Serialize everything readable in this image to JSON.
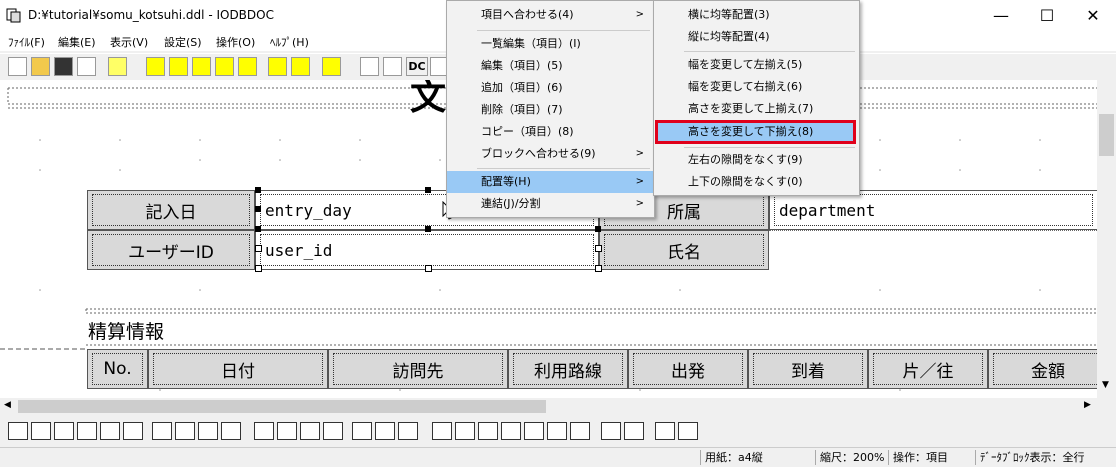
{
  "window": {
    "title": "D:¥tutorial¥somu_kotsuhi.ddl - IODBDOC",
    "controls": {
      "minimize": "—",
      "maximize": "☐",
      "close": "✕"
    }
  },
  "menubar": [
    "ﾌｧｲﾙ(F)",
    "編集(E)",
    "表示(V)",
    "設定(S)",
    "操作(O)",
    "ﾍﾙﾌﾟ(H)"
  ],
  "toolbar": {
    "dc_label": "DC"
  },
  "canvas": {
    "header_char": "文",
    "row1": {
      "label1": "記入日",
      "value1": "entry_day",
      "label2": "所属",
      "value2": "department"
    },
    "row2": {
      "label1": "ユーザーID",
      "value1": "user_id",
      "label2": "氏名"
    },
    "section_title": "精算情報",
    "table_headers": [
      "No.",
      "日付",
      "訪問先",
      "利用路線",
      "出発",
      "到着",
      "片／往",
      "金額"
    ]
  },
  "context_menu": {
    "items": [
      {
        "label": "項目へ合わせる(4)",
        "submenu": true
      },
      {
        "label": "一覧編集（項目）(I)"
      },
      {
        "label": "編集（項目）(5)"
      },
      {
        "label": "追加（項目）(6)"
      },
      {
        "label": "削除（項目）(7)"
      },
      {
        "label": "コピー（項目）(8)"
      },
      {
        "label": "ブロックへ合わせる(9)",
        "submenu": true
      },
      {
        "label": "配置等(H)",
        "submenu": true,
        "highlighted": true
      },
      {
        "label": "連結(J)/分割",
        "submenu": true
      }
    ]
  },
  "submenu": {
    "items": [
      {
        "label": "横に均等配置(3)"
      },
      {
        "label": "縦に均等配置(4)"
      },
      {
        "label": "幅を変更して左揃え(5)"
      },
      {
        "label": "幅を変更して右揃え(6)"
      },
      {
        "label": "高さを変更して上揃え(7)"
      },
      {
        "label": "高さを変更して下揃え(8)",
        "highlighted": true
      },
      {
        "label": "左右の隙間をなくす(9)"
      },
      {
        "label": "上下の隙間をなくす(0)"
      }
    ],
    "highlight_color": "#99c9f5",
    "outline_color": "#e0001b"
  },
  "statusbar": {
    "paper": "用紙：a4縦",
    "zoom": "縮尺：200%",
    "mode": "操作：項目",
    "block": "ﾃﾞｰﾀﾌﾞﾛｯｸ表示：全行"
  }
}
